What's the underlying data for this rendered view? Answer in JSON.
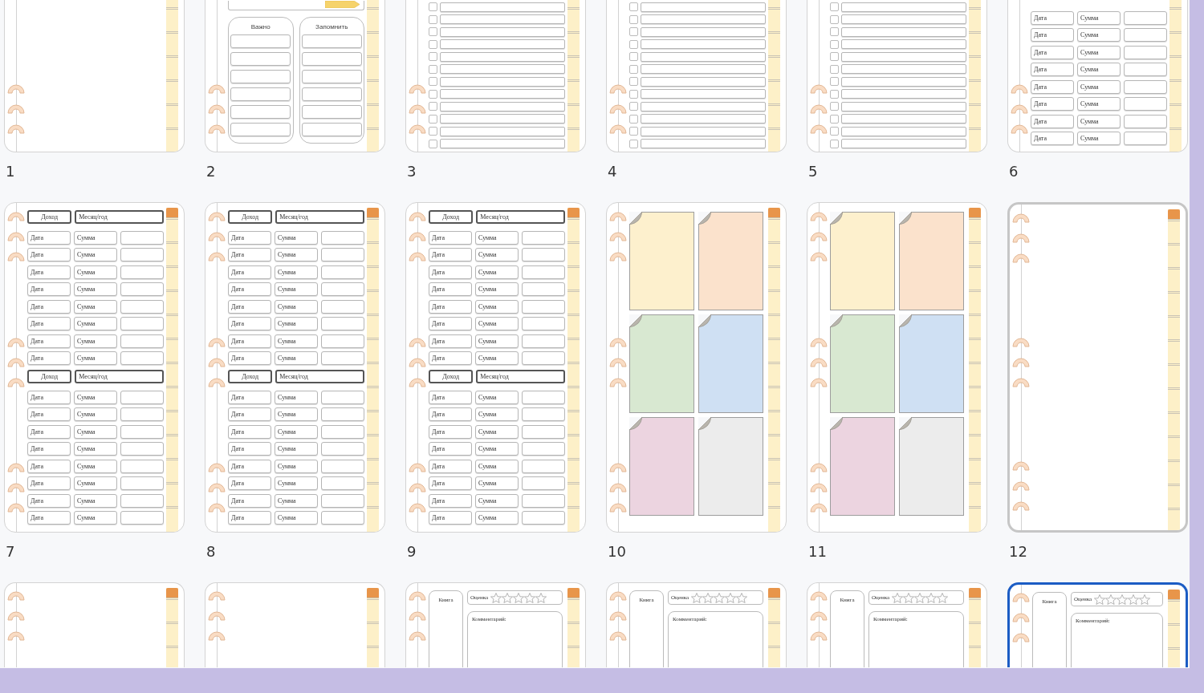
{
  "thumbnails": [
    {
      "number": "1",
      "kind": "blank",
      "selected": false,
      "hovered": false
    },
    {
      "number": "2",
      "kind": "lists",
      "selected": false,
      "hovered": false,
      "lists": [
        {
          "title": "Важно"
        },
        {
          "title": "Запомнить"
        }
      ]
    },
    {
      "number": "3",
      "kind": "checklist",
      "selected": false,
      "hovered": false,
      "items": [
        {
          "checked": false
        },
        {
          "checked": false
        },
        {
          "checked": false
        },
        {
          "checked": false
        },
        {
          "checked": false
        },
        {
          "checked": false
        },
        {
          "checked": false
        },
        {
          "checked": false
        },
        {
          "checked": false
        },
        {
          "checked": false
        },
        {
          "checked": false
        },
        {
          "checked": false
        }
      ]
    },
    {
      "number": "4",
      "kind": "checklist",
      "selected": false,
      "hovered": false,
      "items": [
        {
          "checked": false
        },
        {
          "checked": false
        },
        {
          "checked": false
        },
        {
          "checked": false
        },
        {
          "checked": false
        },
        {
          "checked": false
        },
        {
          "checked": false
        },
        {
          "checked": false
        },
        {
          "checked": false
        },
        {
          "checked": false
        },
        {
          "checked": false
        },
        {
          "checked": false
        }
      ]
    },
    {
      "number": "5",
      "kind": "checklist",
      "selected": false,
      "hovered": false,
      "items": [
        {
          "checked": false
        },
        {
          "checked": false
        },
        {
          "checked": false
        },
        {
          "checked": false
        },
        {
          "checked": false
        },
        {
          "checked": false
        },
        {
          "checked": false
        },
        {
          "checked": false
        },
        {
          "checked": false
        },
        {
          "checked": false
        },
        {
          "checked": false
        },
        {
          "checked": false
        }
      ]
    },
    {
      "number": "6",
      "kind": "table",
      "selected": false,
      "hovered": false,
      "sections": [
        {
          "rows": [
            [
              "Дата",
              "Сумма"
            ],
            [
              "Дата",
              "Сумма"
            ],
            [
              "Дата",
              "Сумма"
            ],
            [
              "Дата",
              "Сумма"
            ],
            [
              "Дата",
              "Сумма"
            ],
            [
              "Дата",
              "Сумма"
            ],
            [
              "Дата",
              "Сумма"
            ],
            [
              "Дата",
              "Сумма"
            ]
          ]
        }
      ]
    },
    {
      "number": "7",
      "kind": "table",
      "selected": false,
      "hovered": false,
      "sections": [
        {
          "header": [
            "Доход",
            "Месяц/год"
          ],
          "rows": [
            [
              "Дата",
              "Сумма"
            ],
            [
              "Дата",
              "Сумма"
            ],
            [
              "Дата",
              "Сумма"
            ],
            [
              "Дата",
              "Сумма"
            ],
            [
              "Дата",
              "Сумма"
            ],
            [
              "Дата",
              "Сумма"
            ],
            [
              "Дата",
              "Сумма"
            ],
            [
              "Дата",
              "Сумма"
            ]
          ]
        },
        {
          "header": [
            "Доход",
            "Месяц/год"
          ],
          "rows": [
            [
              "Дата",
              "Сумма"
            ],
            [
              "Дата",
              "Сумма"
            ],
            [
              "Дата",
              "Сумма"
            ],
            [
              "Дата",
              "Сумма"
            ],
            [
              "Дата",
              "Сумма"
            ],
            [
              "Дата",
              "Сумма"
            ],
            [
              "Дата",
              "Сумма"
            ],
            [
              "Дата",
              "Сумма"
            ]
          ]
        }
      ]
    },
    {
      "number": "8",
      "kind": "table",
      "selected": false,
      "hovered": false,
      "sections": [
        {
          "header": [
            "Доход",
            "Месяц/год"
          ],
          "rows": [
            [
              "Дата",
              "Сумма"
            ],
            [
              "Дата",
              "Сумма"
            ],
            [
              "Дата",
              "Сумма"
            ],
            [
              "Дата",
              "Сумма"
            ],
            [
              "Дата",
              "Сумма"
            ],
            [
              "Дата",
              "Сумма"
            ],
            [
              "Дата",
              "Сумма"
            ],
            [
              "Дата",
              "Сумма"
            ]
          ]
        },
        {
          "header": [
            "Доход",
            "Месяц/год"
          ],
          "rows": [
            [
              "Дата",
              "Сумма"
            ],
            [
              "Дата",
              "Сумма"
            ],
            [
              "Дата",
              "Сумма"
            ],
            [
              "Дата",
              "Сумма"
            ],
            [
              "Дата",
              "Сумма"
            ],
            [
              "Дата",
              "Сумма"
            ],
            [
              "Дата",
              "Сумма"
            ],
            [
              "Дата",
              "Сумма"
            ]
          ]
        }
      ]
    },
    {
      "number": "9",
      "kind": "table",
      "selected": false,
      "hovered": false,
      "sections": [
        {
          "header": [
            "Доход",
            "Месяц/год"
          ],
          "rows": [
            [
              "Дата",
              "Сумма"
            ],
            [
              "Дата",
              "Сумма"
            ],
            [
              "Дата",
              "Сумма"
            ],
            [
              "Дата",
              "Сумма"
            ],
            [
              "Дата",
              "Сумма"
            ],
            [
              "Дата",
              "Сумма"
            ],
            [
              "Дата",
              "Сумма"
            ],
            [
              "Дата",
              "Сумма"
            ]
          ]
        },
        {
          "header": [
            "Доход",
            "Месяц/год"
          ],
          "rows": [
            [
              "Дата",
              "Сумма"
            ],
            [
              "Дата",
              "Сумма"
            ],
            [
              "Дата",
              "Сумма"
            ],
            [
              "Дата",
              "Сумма"
            ],
            [
              "Дата",
              "Сумма"
            ],
            [
              "Дата",
              "Сумма"
            ],
            [
              "Дата",
              "Сумма"
            ],
            [
              "Дата",
              "Сумма"
            ]
          ]
        }
      ]
    },
    {
      "number": "10",
      "kind": "notes",
      "selected": false,
      "hovered": false,
      "notes": [
        {
          "color": "#fdf0cd"
        },
        {
          "color": "#fbe2cc"
        },
        {
          "color": "#d8e8d1"
        },
        {
          "color": "#cfe0f3"
        },
        {
          "color": "#ecd4e0"
        },
        {
          "color": "#ececec"
        }
      ]
    },
    {
      "number": "11",
      "kind": "notes",
      "selected": false,
      "hovered": false,
      "notes": [
        {
          "color": "#fdf0cd"
        },
        {
          "color": "#fbe2cc"
        },
        {
          "color": "#d8e8d1"
        },
        {
          "color": "#cfe0f3"
        },
        {
          "color": "#ecd4e0"
        },
        {
          "color": "#ececec"
        }
      ]
    },
    {
      "number": "12",
      "kind": "blank",
      "selected": false,
      "hovered": true
    },
    {
      "kind": "blank",
      "selected": false,
      "hovered": false
    },
    {
      "kind": "blank",
      "selected": false,
      "hovered": false
    },
    {
      "kind": "book",
      "selected": false,
      "hovered": false,
      "book_label": "Книга",
      "rating_label": "Оценка",
      "stars": 0,
      "comment_label": "Комментарий:"
    },
    {
      "kind": "book",
      "selected": false,
      "hovered": false,
      "book_label": "Книга",
      "rating_label": "Оценка",
      "stars": 0,
      "comment_label": "Комментарий:"
    },
    {
      "kind": "book",
      "selected": false,
      "hovered": false,
      "book_label": "Книга",
      "rating_label": "Оценка",
      "stars": 0,
      "comment_label": "Комментарий:"
    },
    {
      "kind": "book",
      "selected": true,
      "hovered": false,
      "book_label": "Книга",
      "rating_label": "Оценка",
      "stars": 0,
      "comment_label": "Комментарий:"
    }
  ]
}
